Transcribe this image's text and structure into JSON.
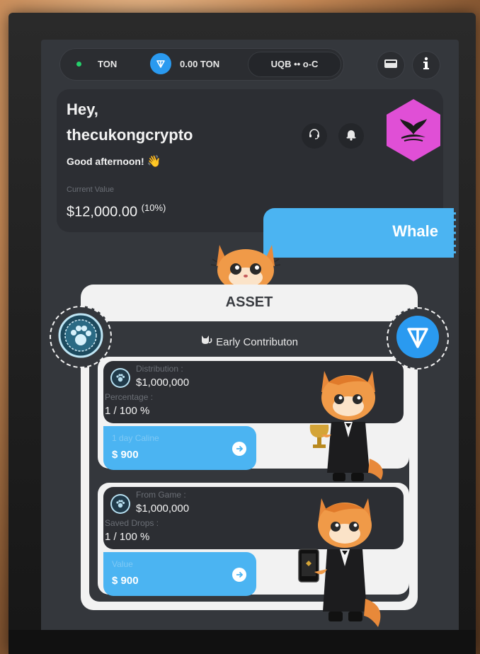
{
  "topbar": {
    "network": "TON",
    "balance": "0.00 TON",
    "address": "UQB •• o-C",
    "wallet_icon": "wallet-icon",
    "info_icon": "info-icon"
  },
  "greeting": {
    "hey": "Hey,",
    "username": "thecukongcrypto",
    "message": "Good afternoon!",
    "wave_emoji": "👋",
    "current_value_label": "Current Value",
    "current_value": "$12,000.00",
    "current_value_pct": "(10%)",
    "rank": "Whale",
    "rank_color": "#e04fd6"
  },
  "asset": {
    "title": "ASSET",
    "subtitle": "Early Contributon",
    "cards": [
      {
        "label1": "Distribution :",
        "value1": "$1,000,000",
        "label2": "Percentage :",
        "value2": "1 / 100 %",
        "bar_label": "1 day Caline",
        "bar_value": "$ 900"
      },
      {
        "label1": "From Game :",
        "value1": "$1,000,000",
        "label2": "Saved Drops :",
        "value2": "1 / 100 %",
        "bar_label": "Value",
        "bar_value": "$ 900"
      }
    ]
  },
  "colors": {
    "accent_blue": "#4bb4f2",
    "ton_blue": "#2a9af0",
    "status_green": "#25d06b",
    "panel_dark": "#2c2e33"
  }
}
